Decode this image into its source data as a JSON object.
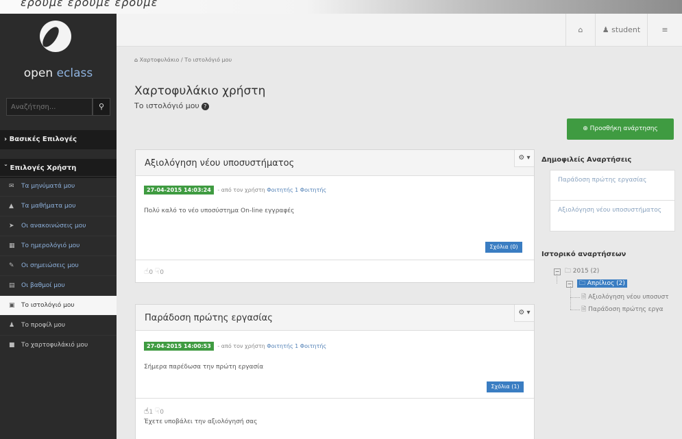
{
  "top_fragment": "ερουμε ερουμε ερουμε",
  "sidebar": {
    "logo_word1": "open",
    "logo_word2": "eclass",
    "search_placeholder": "Αναζήτηση...",
    "section_basic": "Βασικές Επιλογές",
    "section_user": "Επιλογές Χρήστη",
    "menu": [
      {
        "label": "Τα μηνύματά μου",
        "icon": "envelope-icon"
      },
      {
        "label": "Τα μαθήματα μου",
        "icon": "graduation-cap-icon"
      },
      {
        "label": "Οι ανακοινώσεις μου",
        "icon": "bullhorn-icon"
      },
      {
        "label": "Το ημερολόγιό μου",
        "icon": "calendar-icon"
      },
      {
        "label": "Οι σημειώσεις μου",
        "icon": "notes-icon"
      },
      {
        "label": "Οι βαθμοί μου",
        "icon": "grades-icon"
      },
      {
        "label": "Το ιστολόγιό μου",
        "icon": "blog-icon",
        "active": true
      },
      {
        "label": "Το προφίλ μου",
        "icon": "user-icon"
      },
      {
        "label": "Το χαρτοφυλάκιό μου",
        "icon": "portfolio-icon"
      }
    ]
  },
  "topbar": {
    "username": "student"
  },
  "breadcrumb": {
    "home": "Χαρτοφυλάκιο",
    "current": "Το ιστολόγιό μου"
  },
  "page": {
    "title": "Χαρτοφυλάκιο χρήστη",
    "subtitle": "Το ιστολόγιό μου",
    "add_button": "Προσθήκη ανάρτησης"
  },
  "posts": [
    {
      "title": "Αξιολόγηση νέου υποσυστήματος",
      "date": "27-04-2015 14:03:24",
      "by": "- από τον χρήστη",
      "author": "Φοιτητής 1 Φοιτητής",
      "body": "Πολύ καλό το νέο υποσύστημα On-line εγγραφές",
      "comments": "Σχόλια (0)",
      "likes": "0",
      "dislikes": "0",
      "note": ""
    },
    {
      "title": "Παράδοση πρώτης εργασίας",
      "date": "27-04-2015 14:00:53",
      "by": "- από τον χρήστη",
      "author": "Φοιτητής 1 Φοιτητής",
      "body": "Σήμερα παρέδωσα την πρώτη εργασία",
      "comments": "Σχόλια (1)",
      "likes": "1",
      "dislikes": "0",
      "note": "Έχετε υποβάλει την αξιολόγησή σας"
    }
  ],
  "popular": {
    "heading": "Δημοφιλείς Αναρτήσεις",
    "items": [
      "Παράδοση πρώτης εργασίας",
      "Αξιολόγηση νέου υποσυστήματος"
    ]
  },
  "history": {
    "heading": "Ιστορικό αναρτήσεων",
    "year": "2015 (2)",
    "month": "Απρίλιος (2)",
    "entries": [
      "Αξιολόγηση νέου υποσυστ",
      "Παράδοση πρώτης εργα"
    ]
  }
}
